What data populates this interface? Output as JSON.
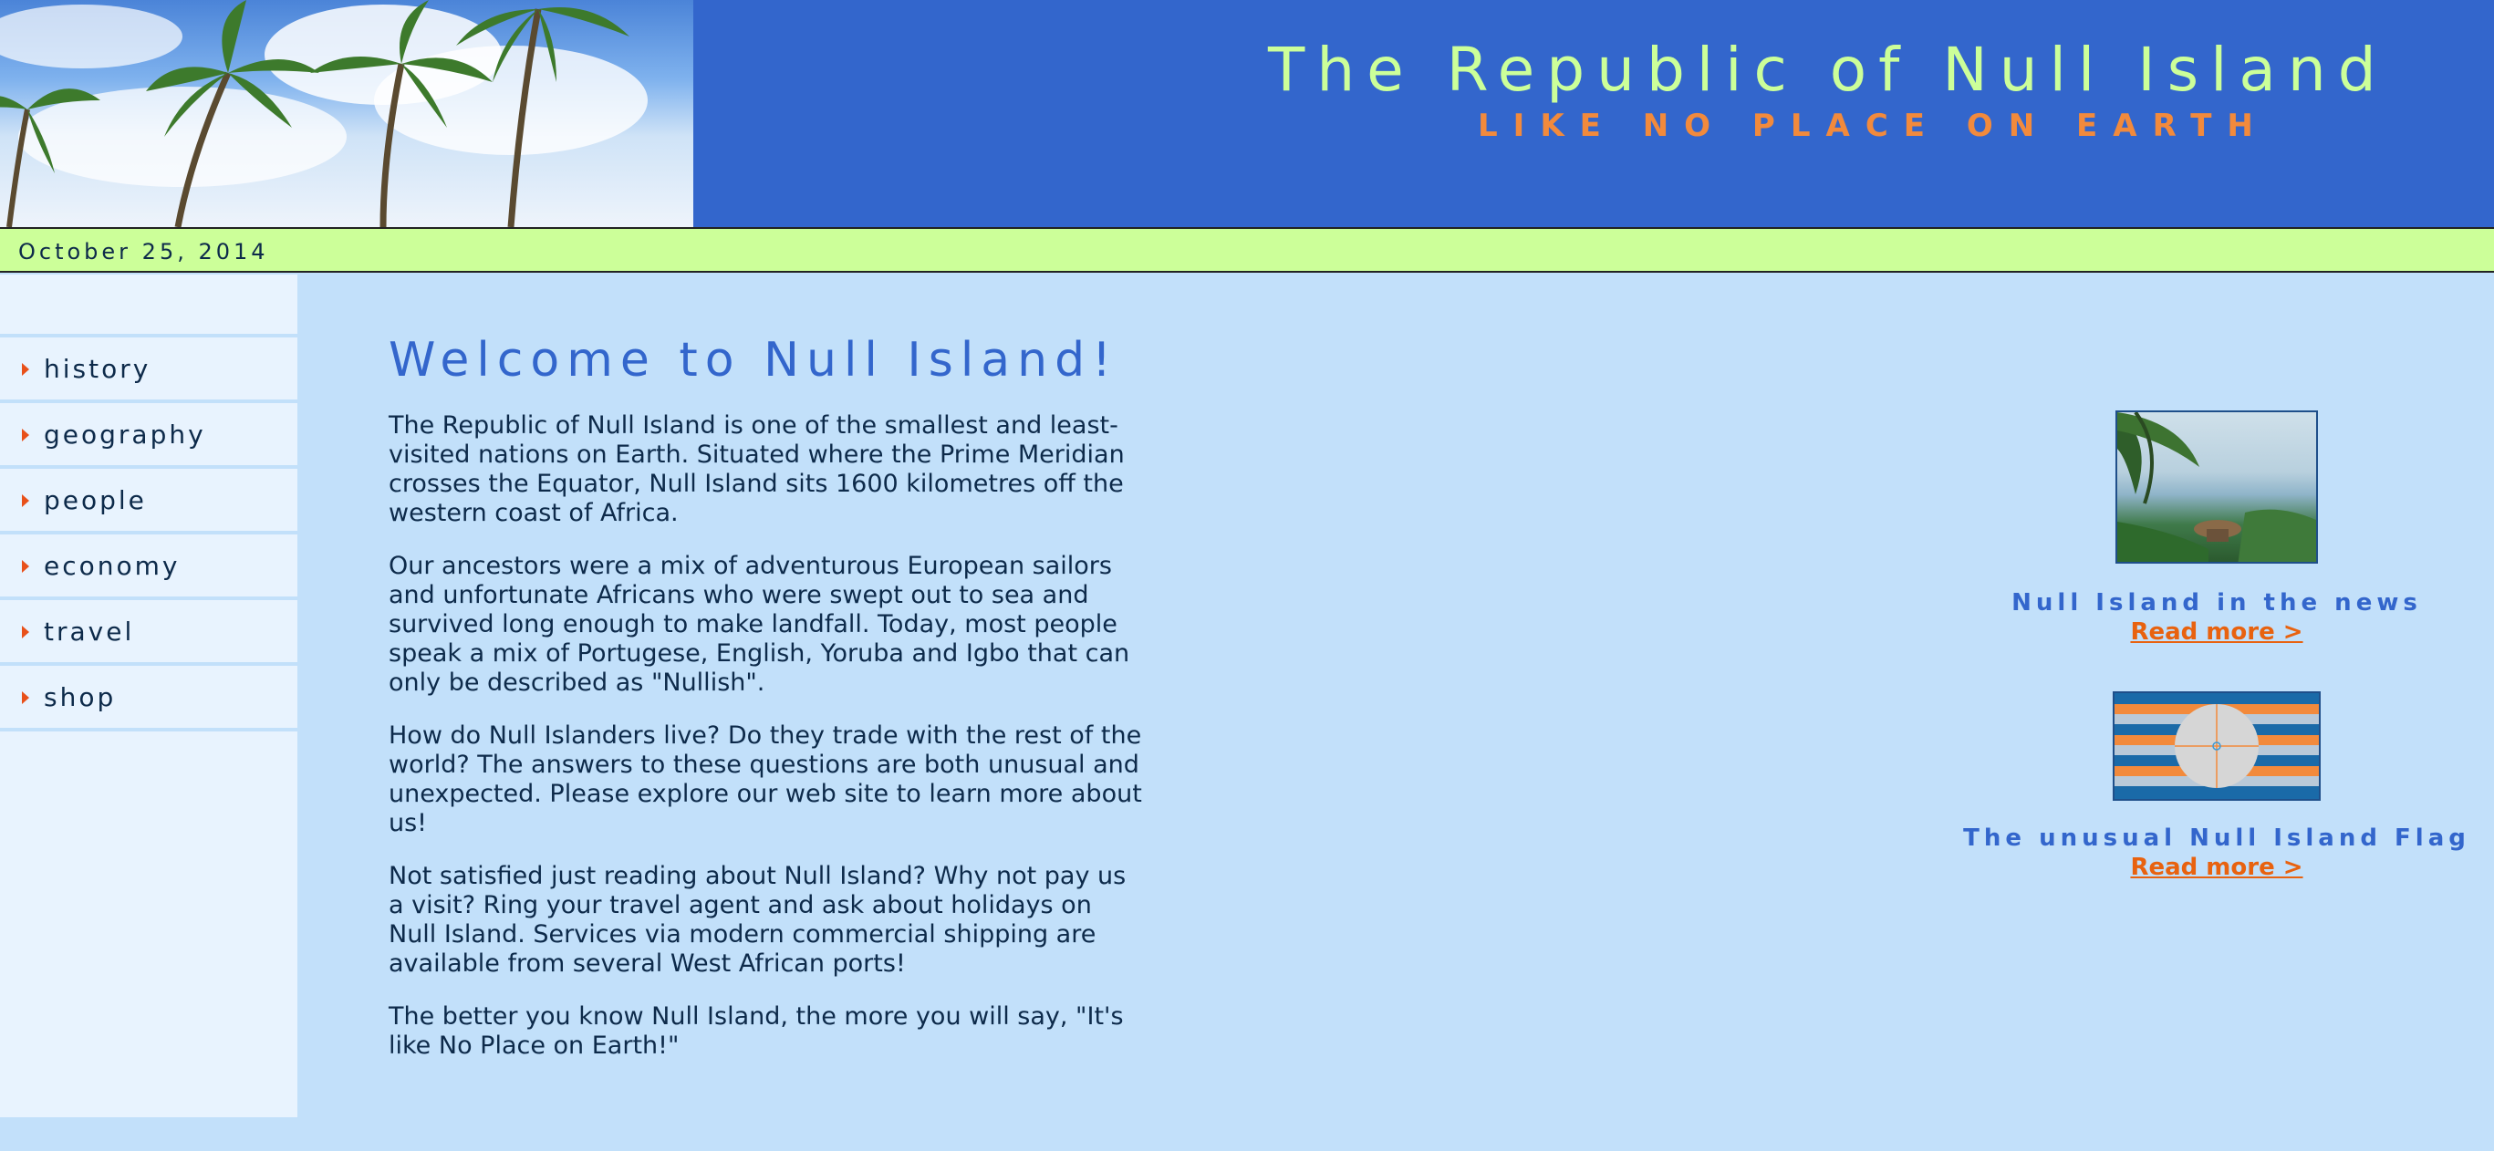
{
  "header": {
    "title": "The Republic of Null Island",
    "tagline": "LIKE NO PLACE ON EARTH"
  },
  "date": "October 25, 2014",
  "nav": [
    {
      "label": "history"
    },
    {
      "label": "geography"
    },
    {
      "label": "people"
    },
    {
      "label": "economy"
    },
    {
      "label": "travel"
    },
    {
      "label": "shop"
    }
  ],
  "main": {
    "heading": "Welcome to Null Island!",
    "paragraphs": [
      "The Republic of Null Island is one of the smallest and least-visited nations on Earth. Situated where the Prime Meridian crosses the Equator, Null Island sits 1600 kilometres off the western coast of Africa.",
      "Our ancestors were a mix of adventurous European sailors and unfortunate Africans who were swept out to sea and survived long enough to make landfall. Today, most people speak a mix of Portugese, English, Yoruba and Igbo that can only be described as \"Nullish\".",
      "How do Null Islanders live? Do they trade with the rest of the world? The answers to these questions are both unusual and unexpected. Please explore our web site to learn more about us!",
      "Not satisfied just reading about Null Island? Why not pay us a visit? Ring your travel agent and ask about holidays on Null Island. Services via modern commercial shipping are available from several West African ports!",
      "The better you know Null Island, the more you will say, \"It's like No Place on Earth!\""
    ]
  },
  "aside": {
    "news_title": "Null Island in the news",
    "news_link": "Read more >",
    "flag_title": "The unusual Null Island Flag",
    "flag_link": "Read more >"
  },
  "colors": {
    "header_bg": "#3366cc",
    "title": "#ccff99",
    "tagline": "#f28a3c",
    "datebar": "#ccff99",
    "page_bg": "#c2e0fa",
    "sidebar_bg": "#e8f3fe",
    "link": "#e8620f"
  }
}
